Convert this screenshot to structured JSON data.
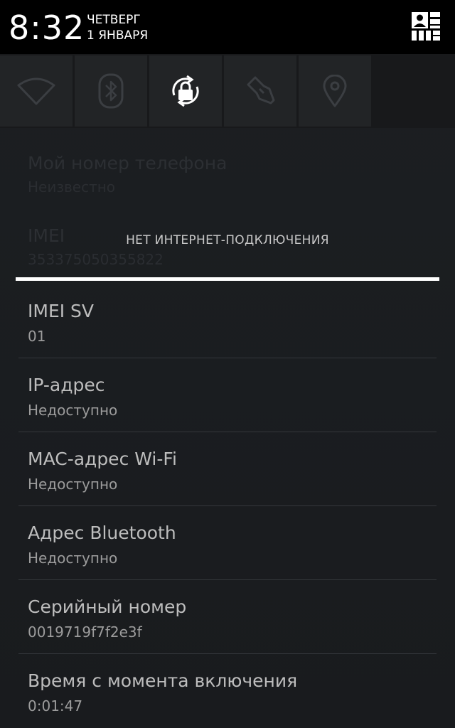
{
  "status": {
    "time": "8:32",
    "day": "ЧЕТВЕРГ",
    "date": "1 ЯНВАРЯ",
    "user_icon": "user-switch-icon"
  },
  "quick_settings": [
    {
      "name": "wifi",
      "icon": "wifi-icon"
    },
    {
      "name": "bluetooth",
      "icon": "bluetooth-icon"
    },
    {
      "name": "rotation",
      "icon": "rotation-lock-icon"
    },
    {
      "name": "flashlight",
      "icon": "flashlight-icon"
    },
    {
      "name": "location",
      "icon": "location-icon"
    }
  ],
  "dimmed_items": [
    {
      "title": "Мой номер телефона",
      "value": "Неизвестно"
    },
    {
      "title": "IMEI",
      "value": "353375050355822"
    }
  ],
  "notification": "НЕТ ИНТЕРНЕТ-ПОДКЛЮЧЕНИЯ",
  "items": [
    {
      "title": "IMEI SV",
      "value": "01"
    },
    {
      "title": "IP-адрес",
      "value": "Недоступно"
    },
    {
      "title": "MAC-адрес Wi-Fi",
      "value": "Недоступно"
    },
    {
      "title": "Адрес Bluetooth",
      "value": "Недоступно"
    },
    {
      "title": "Серийный номер",
      "value": "0019719f7f2e3f"
    },
    {
      "title": "Время с момента включения",
      "value": "0:01:47"
    }
  ],
  "colors": {
    "background": "#1b1d20",
    "status_bar": "#000000",
    "title_text": "#bdbdbd",
    "subtitle_text": "#9c9c9c",
    "accent_line": "#ffffff"
  }
}
